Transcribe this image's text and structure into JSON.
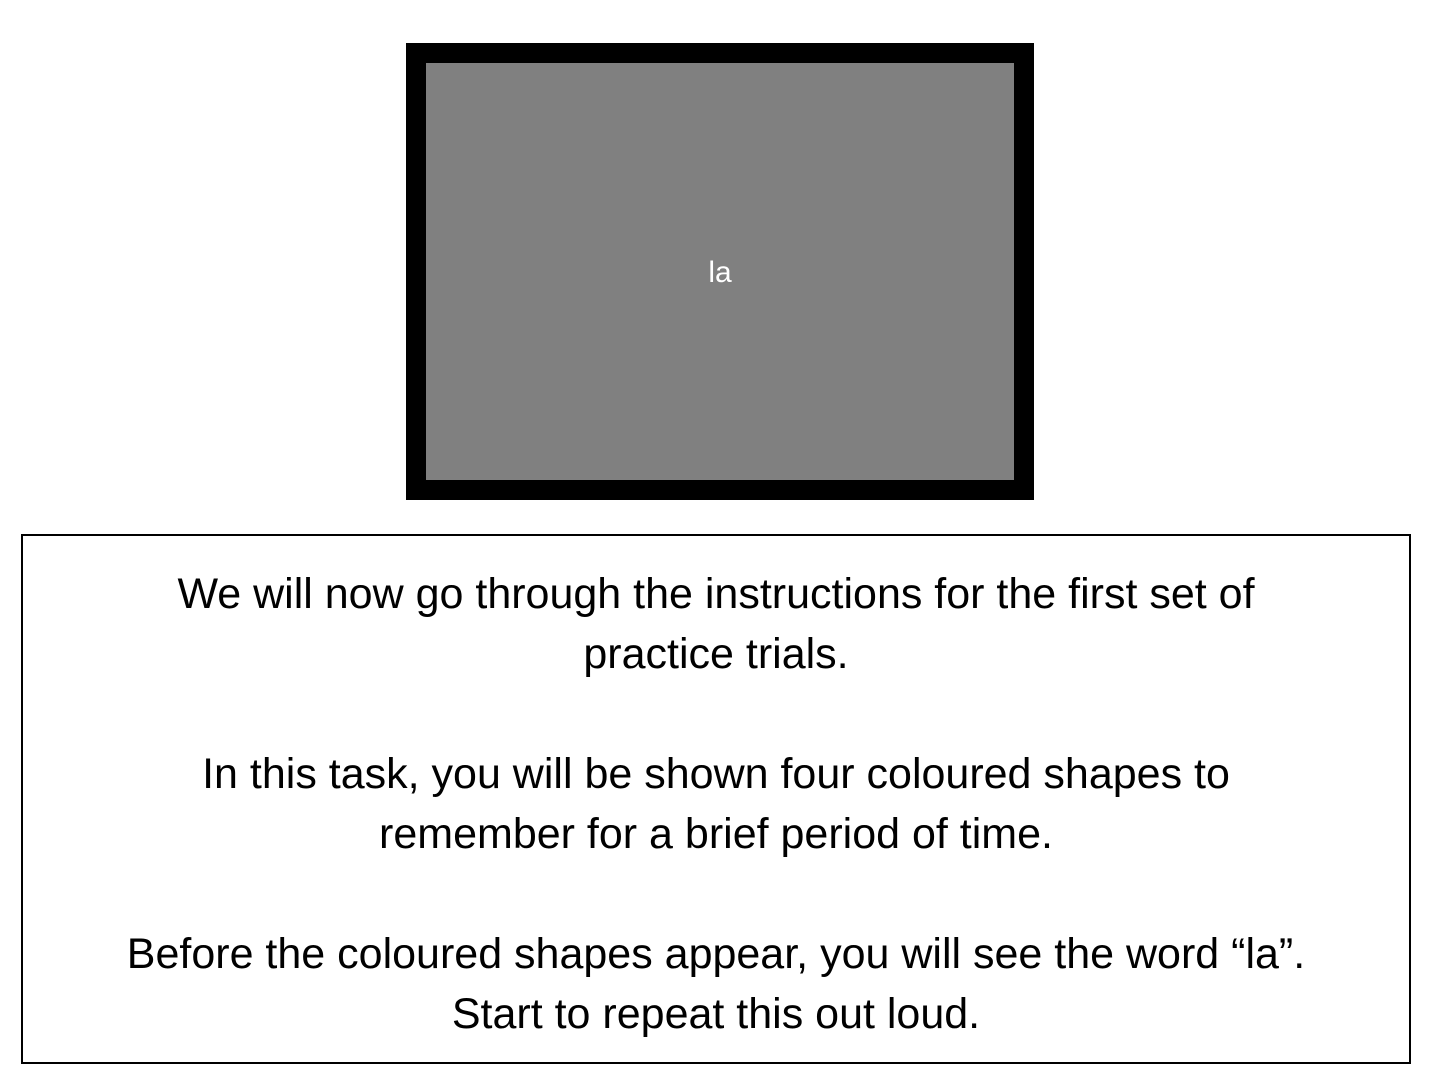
{
  "stimulus": {
    "word": "la"
  },
  "instructions": {
    "paragraphs": [
      {
        "lines": [
          "We will now go through the instructions for the first set of",
          "practice trials."
        ]
      },
      {
        "lines": [
          "In this task, you will be shown four coloured shapes to",
          "remember for a brief period of time."
        ]
      },
      {
        "lines": [
          "Before the coloured shapes appear, you will see the word “la”.",
          "Start to repeat this out loud."
        ]
      }
    ]
  },
  "colors": {
    "frame": "#000000",
    "screen": "#808080",
    "stimulus_text": "#ffffff",
    "background": "#ffffff",
    "instruction_text": "#000000"
  }
}
